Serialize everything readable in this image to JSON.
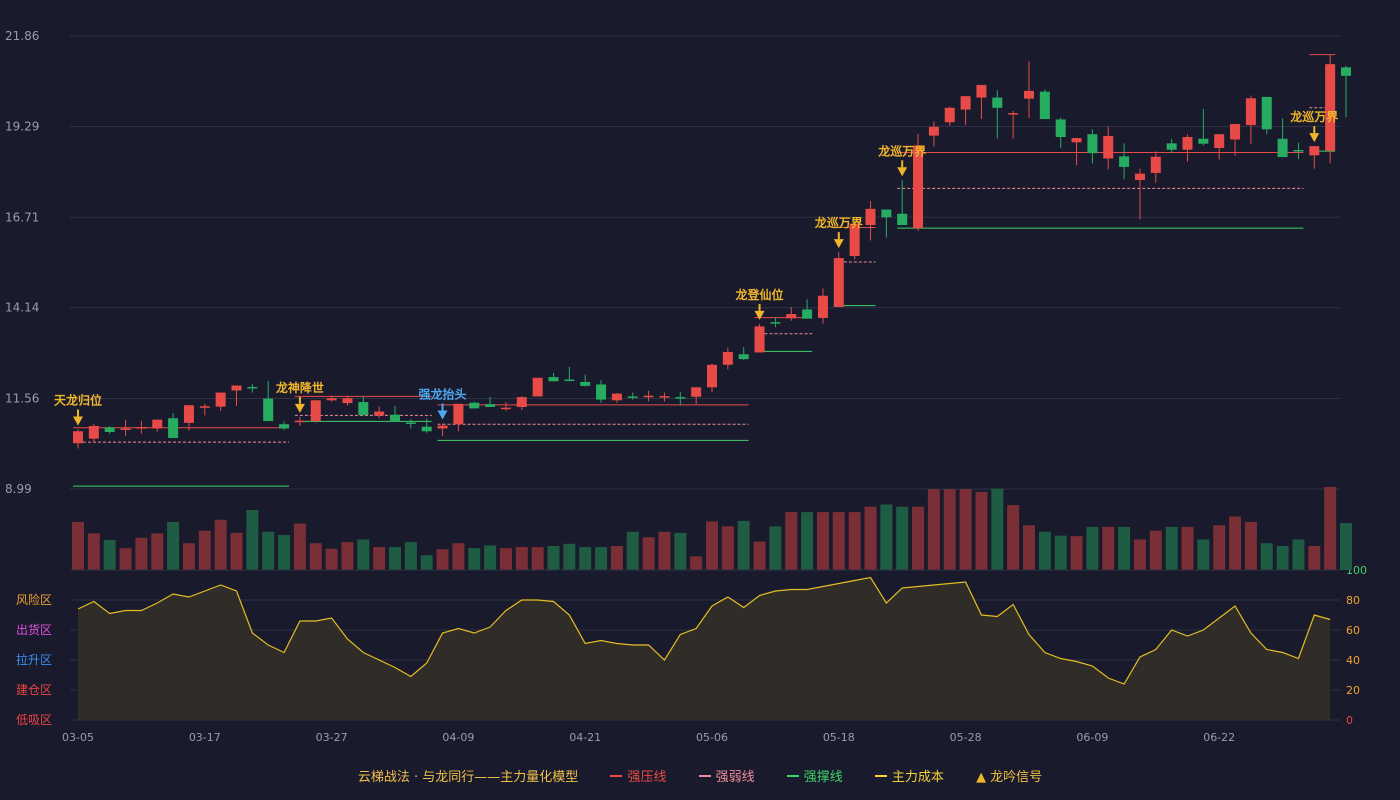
{
  "colors": {
    "background": "#191a2c",
    "up": "#e84b47",
    "down": "#27ad62",
    "vol_up": "#7a2e36",
    "vol_down": "#1e5c44",
    "grid": "#2f3145",
    "axis_text": "#9a9cab",
    "signal_gold": "#f0b52a",
    "signal_blue": "#4ea6f0",
    "pressure": "#e84b47",
    "weak": "#f08c97",
    "support": "#3fd067",
    "cost": "#f3d23a",
    "zone_risk": "#f0a030",
    "zone_ship": "#e34fe0",
    "zone_rise": "#3c8fef",
    "zone_build": "#ee4343",
    "zone_low": "#ee4343",
    "osc_line": "#e3bd22",
    "osc_fill": "#302c28"
  },
  "legend": {
    "title": "云梯战法 · 与龙同行——主力量化模型",
    "pressure": "强压线",
    "weak": "强弱线",
    "support": "强撑线",
    "cost": "主力成本",
    "signal": "龙吟信号",
    "signal_symbol": "▲"
  },
  "chart_data": [
    {
      "type": "candlestick",
      "title": "",
      "y_axis_ticks": [
        "8.99",
        "11.56",
        "14.14",
        "16.71",
        "19.29",
        "21.86"
      ],
      "ylim": [
        8.99,
        21.86
      ],
      "x_tick_labels": [
        "03-05",
        "03-17",
        "03-27",
        "04-09",
        "04-21",
        "05-06",
        "05-18",
        "05-28",
        "06-09",
        "06-22"
      ],
      "x_tick_indices": [
        0,
        8,
        16,
        24,
        32,
        40,
        48,
        56,
        64,
        72
      ],
      "ohlc": [
        [
          10.29,
          10.68,
          10.14,
          10.63
        ],
        [
          10.42,
          10.84,
          10.31,
          10.78
        ],
        [
          10.74,
          10.78,
          10.56,
          10.61
        ],
        [
          10.67,
          10.96,
          10.5,
          10.71
        ],
        [
          10.72,
          10.93,
          10.56,
          10.75
        ],
        [
          10.71,
          10.91,
          10.62,
          10.96
        ],
        [
          11.0,
          11.15,
          10.69,
          10.44
        ],
        [
          10.87,
          11.32,
          10.65,
          11.37
        ],
        [
          11.31,
          11.41,
          11.08,
          11.34
        ],
        [
          11.33,
          11.64,
          11.21,
          11.73
        ],
        [
          11.79,
          11.87,
          11.35,
          11.93
        ],
        [
          11.89,
          11.97,
          11.73,
          11.85
        ],
        [
          11.56,
          12.06,
          11.36,
          10.92
        ],
        [
          10.83,
          10.91,
          10.67,
          10.71
        ],
        [
          10.89,
          11.04,
          10.78,
          10.93
        ],
        [
          10.92,
          11.48,
          10.87,
          11.51
        ],
        [
          11.51,
          11.64,
          11.47,
          11.57
        ],
        [
          11.43,
          11.64,
          11.36,
          11.57
        ],
        [
          11.46,
          11.61,
          11.2,
          11.09
        ],
        [
          11.08,
          11.33,
          11.0,
          11.19
        ],
        [
          11.1,
          11.35,
          10.9,
          10.91
        ],
        [
          10.88,
          10.98,
          10.71,
          10.85
        ],
        [
          10.76,
          10.99,
          10.59,
          10.63
        ],
        [
          10.71,
          10.85,
          10.49,
          10.79
        ],
        [
          10.83,
          11.37,
          10.63,
          11.41
        ],
        [
          11.44,
          11.48,
          11.34,
          11.28
        ],
        [
          11.4,
          11.61,
          11.32,
          11.32
        ],
        [
          11.3,
          11.46,
          11.21,
          11.3
        ],
        [
          11.32,
          11.63,
          11.23,
          11.6
        ],
        [
          11.62,
          12.12,
          11.67,
          12.15
        ],
        [
          12.17,
          12.29,
          12.08,
          12.05
        ],
        [
          12.1,
          12.46,
          12.05,
          12.06
        ],
        [
          12.03,
          12.24,
          11.9,
          11.92
        ],
        [
          11.96,
          12.08,
          11.44,
          11.53
        ],
        [
          11.51,
          11.72,
          11.44,
          11.7
        ],
        [
          11.62,
          11.73,
          11.53,
          11.6
        ],
        [
          11.6,
          11.78,
          11.48,
          11.64
        ],
        [
          11.63,
          11.73,
          11.47,
          11.63
        ],
        [
          11.6,
          11.75,
          11.36,
          11.56
        ],
        [
          11.61,
          11.84,
          11.41,
          11.88
        ],
        [
          11.88,
          12.55,
          11.74,
          12.52
        ],
        [
          12.52,
          13.01,
          12.39,
          12.88
        ],
        [
          12.82,
          13.02,
          12.65,
          12.68
        ],
        [
          12.87,
          13.68,
          12.88,
          13.61
        ],
        [
          13.73,
          13.87,
          13.59,
          13.69
        ],
        [
          13.84,
          14.16,
          13.77,
          13.96
        ],
        [
          14.09,
          14.38,
          13.93,
          13.83
        ],
        [
          13.85,
          14.69,
          13.69,
          14.48
        ],
        [
          14.16,
          15.72,
          14.23,
          15.55
        ],
        [
          15.61,
          16.43,
          15.51,
          16.53
        ],
        [
          16.49,
          17.17,
          16.05,
          16.95
        ],
        [
          16.93,
          16.87,
          16.13,
          16.71
        ],
        [
          16.81,
          17.76,
          16.5,
          16.49
        ],
        [
          16.4,
          19.08,
          16.32,
          18.75
        ],
        [
          19.03,
          19.43,
          18.72,
          19.28
        ],
        [
          19.41,
          19.85,
          19.31,
          19.82
        ],
        [
          19.77,
          20.06,
          19.33,
          20.15
        ],
        [
          20.11,
          20.43,
          19.5,
          20.47
        ],
        [
          20.11,
          20.32,
          18.95,
          19.82
        ],
        [
          19.64,
          19.73,
          18.94,
          19.67
        ],
        [
          20.08,
          21.14,
          19.53,
          20.3
        ],
        [
          20.28,
          20.34,
          19.51,
          19.5
        ],
        [
          19.49,
          19.54,
          18.68,
          18.99
        ],
        [
          18.84,
          18.91,
          18.19,
          18.96
        ],
        [
          19.07,
          19.21,
          18.24,
          18.53
        ],
        [
          18.38,
          19.29,
          18.07,
          19.02
        ],
        [
          18.44,
          18.81,
          17.79,
          18.14
        ],
        [
          17.77,
          18.09,
          16.65,
          17.95
        ],
        [
          17.97,
          18.58,
          17.69,
          18.43
        ],
        [
          18.81,
          18.94,
          18.53,
          18.63
        ],
        [
          18.63,
          19.06,
          18.29,
          18.99
        ],
        [
          18.94,
          19.79,
          18.75,
          18.8
        ],
        [
          18.68,
          18.96,
          18.35,
          19.07
        ],
        [
          18.92,
          19.35,
          18.46,
          19.36
        ],
        [
          19.33,
          20.17,
          18.8,
          20.09
        ],
        [
          20.13,
          19.91,
          19.07,
          19.21
        ],
        [
          18.94,
          19.52,
          18.6,
          18.42
        ],
        [
          18.62,
          18.83,
          18.36,
          18.61
        ],
        [
          18.47,
          18.69,
          18.09,
          18.73
        ],
        [
          18.6,
          21.32,
          18.24,
          21.06
        ],
        [
          20.97,
          21.01,
          19.55,
          20.73
        ]
      ],
      "volume": [
        88,
        67,
        55,
        40,
        59,
        67,
        88,
        49,
        72,
        92,
        68,
        110,
        70,
        64,
        85,
        49,
        39,
        51,
        56,
        42,
        42,
        51,
        27,
        38,
        49,
        40,
        45,
        40,
        42,
        42,
        44,
        48,
        42,
        42,
        44,
        70,
        60,
        70,
        68,
        25,
        89,
        80,
        90,
        52,
        80,
        106,
        106,
        106,
        106,
        106,
        116,
        120,
        116,
        116,
        148,
        148,
        148,
        143,
        149,
        119,
        82,
        70,
        63,
        62,
        79,
        79,
        79,
        56,
        72,
        79,
        79,
        56,
        82,
        98,
        88,
        49,
        44,
        56,
        44,
        152,
        86
      ],
      "oscillator": [
        74,
        79,
        71,
        73,
        73,
        78,
        84,
        82,
        86,
        90,
        86,
        58,
        50,
        45,
        66,
        66,
        68,
        54,
        45,
        40,
        35,
        29,
        38,
        58,
        61,
        58,
        62,
        73,
        80,
        80,
        79,
        70,
        51,
        53,
        51,
        50,
        50,
        40,
        57,
        61,
        76,
        82,
        75,
        83,
        86,
        87,
        87,
        89,
        91,
        93,
        95,
        78,
        88,
        89,
        90,
        91,
        92,
        70,
        69,
        77,
        57,
        45,
        41,
        39,
        36,
        28,
        24,
        42,
        47,
        60,
        56,
        60,
        68,
        76,
        58,
        47,
        45,
        41,
        70,
        67
      ],
      "y_ticks_osc": [
        "0",
        "20",
        "40",
        "60",
        "80",
        "100"
      ],
      "zones": [
        "风险区",
        "出货区",
        "拉升区",
        "建仓区",
        "低吸区"
      ],
      "signals": [
        {
          "index": 0,
          "label": "天龙归位",
          "color": "gold"
        },
        {
          "index": 14,
          "label": "龙神降世",
          "color": "gold"
        },
        {
          "index": 23,
          "label": "强龙抬头",
          "color": "blue"
        },
        {
          "index": 43,
          "label": "龙登仙位",
          "color": "gold"
        },
        {
          "index": 48,
          "label": "龙巡万界",
          "color": "gold"
        },
        {
          "index": 52,
          "label": "龙巡万界",
          "color": "gold"
        },
        {
          "index": 78,
          "label": "龙巡万界",
          "color": "gold"
        }
      ],
      "levels": [
        {
          "from": 0,
          "to": 13,
          "pressure": 10.73,
          "weak": 10.32,
          "support": 9.07
        },
        {
          "from": 14,
          "to": 22,
          "pressure": 11.62,
          "weak": 11.08,
          "support": 10.91
        },
        {
          "from": 23,
          "to": 42,
          "pressure": 11.38,
          "weak": 10.83,
          "support": 10.37
        },
        {
          "from": 43,
          "to": 46,
          "pressure": 13.86,
          "weak": 13.4,
          "support": 12.9
        },
        {
          "from": 48,
          "to": 50,
          "pressure": 16.42,
          "weak": 15.44,
          "support": 14.2
        },
        {
          "from": 52,
          "to": 77,
          "pressure": 18.55,
          "weak": 17.53,
          "support": 16.4
        },
        {
          "from": 78,
          "to": 79,
          "pressure": 21.33,
          "weak": 19.82,
          "support": 18.59
        }
      ]
    }
  ]
}
